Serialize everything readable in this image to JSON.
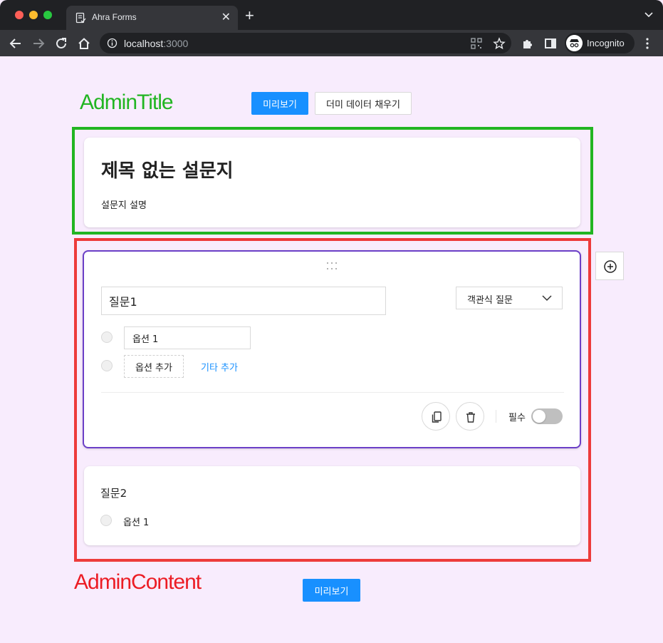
{
  "browser": {
    "tab_title": "Ahra Forms",
    "tab_close": "✕",
    "new_tab": "+",
    "url_host": "localhost",
    "url_port": ":3000",
    "profile_label": "Incognito"
  },
  "header": {
    "admin_title_label": "AdminTitle",
    "preview_button": "미리보기",
    "dummy_button": "더미 데이터 채우기"
  },
  "form": {
    "title": "제목 없는 설문지",
    "description": "설문지 설명"
  },
  "question1": {
    "title_value": "질문1",
    "type_label": "객관식 질문",
    "option1_value": "옵션 1",
    "add_option_label": "옵션 추가",
    "add_etc_label": "기타 추가",
    "required_label": "필수",
    "required": false
  },
  "question2": {
    "title": "질문2",
    "option1": "옵션 1"
  },
  "footer": {
    "admin_content_label": "AdminContent",
    "preview_button": "미리보기"
  },
  "colors": {
    "accent": "#1890ff",
    "admin_title_frame": "#22b522",
    "admin_content_frame": "#ed3b3b",
    "active_card_border": "#6b3fc7",
    "page_background": "#f8ecfd"
  },
  "icons": [
    "document-icon",
    "back-arrow-icon",
    "forward-arrow-icon",
    "reload-icon",
    "home-icon",
    "info-icon",
    "qr-icon",
    "star-icon",
    "extensions-icon",
    "sidebar-icon",
    "incognito-icon",
    "kebab-menu-icon",
    "drag-handle-icon",
    "chevron-down-icon",
    "copy-icon",
    "trash-icon",
    "add-circle-icon"
  ]
}
